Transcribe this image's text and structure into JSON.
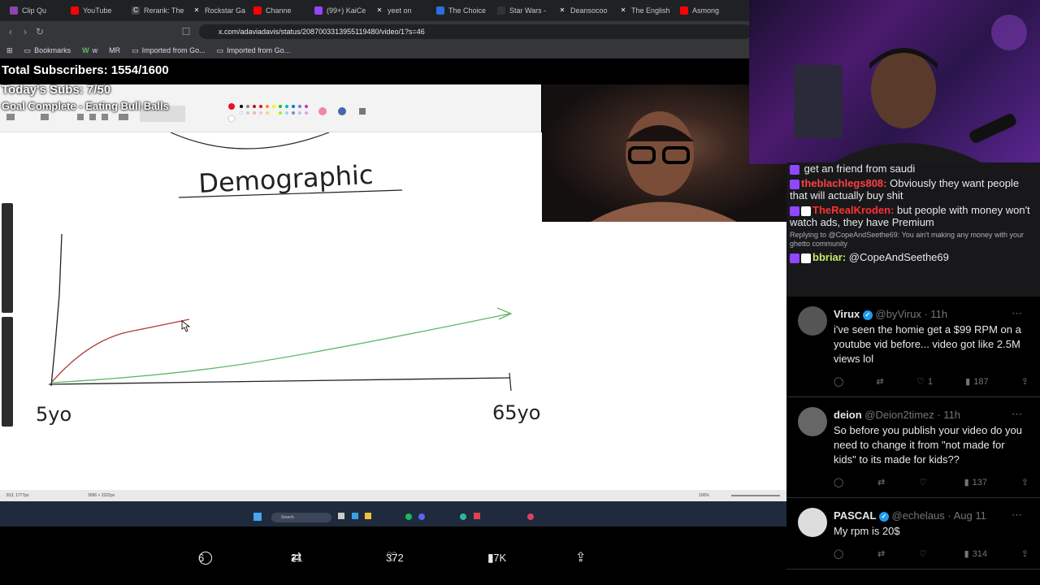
{
  "browser": {
    "tabs": [
      {
        "label": "Clip Qu",
        "color": "#8e44ad"
      },
      {
        "label": "YouTube",
        "color": "#ff0000"
      },
      {
        "label": "Rerank: The",
        "color": "#444444"
      },
      {
        "label": "Rockstar Ga",
        "color": "#000000"
      },
      {
        "label": "Channe",
        "color": "#ff0000"
      },
      {
        "label": "(99+) KaiCe",
        "color": "#9146ff"
      },
      {
        "label": "yeet on",
        "color": "#000000"
      },
      {
        "label": "The Choice",
        "color": "#2a6fdb"
      },
      {
        "label": "Star Wars -",
        "color": "#333333"
      },
      {
        "label": "Deansocoo",
        "color": "#000000"
      },
      {
        "label": "The English",
        "color": "#000000"
      },
      {
        "label": "Asmong",
        "color": "#ff0000"
      }
    ],
    "url": "x.com/adaviadavis/status/2087003313955119480/video/1?s=46",
    "bookmarks": [
      "Bookmarks",
      "w",
      "MR",
      "Imported from Go...",
      "Imported from Go..."
    ]
  },
  "overlay": {
    "total_subs": "Total Subscribers: 1554/1600",
    "todays_subs": "Today's Subs: 7/50",
    "goal": "Goal Complete - Eating Bull Balls"
  },
  "whiteboard": {
    "title": "Demographic",
    "x_start_label": "5yo",
    "x_end_label": "65yo",
    "red_color": "#b03a3a",
    "green_color": "#5fb86a",
    "taskbar_search": "Search",
    "status_left": "813, 1777px",
    "status_mid": "3096 × 2322px",
    "zoom": "100%"
  },
  "chat": {
    "lines": [
      {
        "user": "",
        "user_color": "#ff6b6b",
        "text": "get an friend from saudi"
      },
      {
        "user": "theblachlegs808:",
        "user_color": "#ff4040",
        "text": "Obviously they want people that will actually buy shit"
      },
      {
        "user": "TheRealKroden:",
        "user_color": "#ff3030",
        "text": "but people with money won't watch ads, they have Premium"
      },
      {
        "user": "",
        "user_color": "#adadb8",
        "text": "Replying to @CopeAndSeethe69: You ain't making any money with your ghetto community"
      },
      {
        "user": "bbriar:",
        "user_color": "#c6e96b",
        "text": "@CopeAndSeethe69"
      }
    ]
  },
  "tweets": [
    {
      "name": "Virux",
      "verified": true,
      "handle": "@byVirux · 11h",
      "text": "i've seen the homie get a $99 RPM on a youtube vid before... video got like 2.5M views lol",
      "likes": "1",
      "views": "187"
    },
    {
      "name": "deion",
      "verified": false,
      "handle": "@Deion2timez · 11h",
      "text": "So before you publish your video do you need to change it from \"not made for kids\" to its made for kids??",
      "likes": "",
      "views": "137"
    },
    {
      "name": "PASCAL",
      "verified": true,
      "handle": "@echelaus · Aug 11",
      "text": "My rpm is 20$",
      "likes": "",
      "views": "314"
    }
  ],
  "actionbar": {
    "replies": "6",
    "reposts": "21",
    "likes": "372",
    "views": "17K"
  }
}
